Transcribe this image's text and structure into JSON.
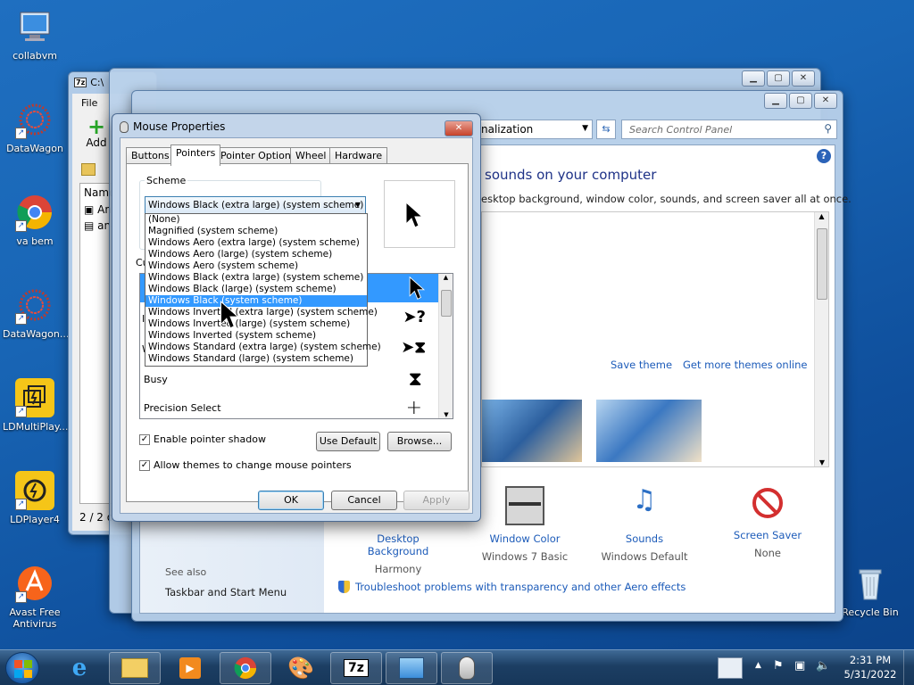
{
  "desktop_icons": [
    {
      "label": "collabvm"
    },
    {
      "label": "DataWagon"
    },
    {
      "label": "va bem"
    },
    {
      "label": "DataWagon..."
    },
    {
      "label": "LDMultiPlay..."
    },
    {
      "label": "LDPlayer4"
    },
    {
      "label": "Avast Free Antivirus"
    },
    {
      "label": "Recycle Bin"
    }
  ],
  "sevenzip_window": {
    "title": "C:\\",
    "menu_file": "File",
    "add_label": "Add",
    "col_name": "Name",
    "row1": "An",
    "row2": "ang",
    "status": "2 / 2 ob"
  },
  "control_panel": {
    "breadcrumb": "nalization",
    "search_placeholder": "Search Control Panel",
    "heading": "sounds on your computer",
    "subheading": "esktop background, window color, sounds, and screen saver all at once.",
    "save_theme": "Save theme",
    "get_more_themes": "Get more themes online",
    "bottom_items": [
      {
        "label": "Desktop Background",
        "value": "Harmony"
      },
      {
        "label": "Window Color",
        "value": "Windows 7 Basic"
      },
      {
        "label": "Sounds",
        "value": "Windows Default"
      },
      {
        "label": "Screen Saver",
        "value": "None"
      }
    ],
    "see_also": "See also",
    "taskbar_link": "Taskbar and Start Menu",
    "troubleshoot": "Troubleshoot problems with transparency and other Aero effects"
  },
  "mouse_dialog": {
    "title": "Mouse Properties",
    "tabs": [
      "Buttons",
      "Pointers",
      "Pointer Options",
      "Wheel",
      "Hardware"
    ],
    "scheme_label": "Scheme",
    "scheme_value": "Windows Black (extra large) (system scheme)",
    "scheme_options": [
      "(None)",
      "Magnified (system scheme)",
      "Windows Aero (extra large) (system scheme)",
      "Windows Aero (large) (system scheme)",
      "Windows Aero (system scheme)",
      "Windows Black (extra large) (system scheme)",
      "Windows Black (large) (system scheme)",
      "Windows Black (system scheme)",
      "Windows Inverted (extra large) (system scheme)",
      "Windows Inverted (large) (system scheme)",
      "Windows Inverted (system scheme)",
      "Windows Standard (extra large) (system scheme)",
      "Windows Standard (large) (system scheme)"
    ],
    "highlighted_index": 7,
    "customize_label": "Cu",
    "list_partials": [
      "I",
      "W"
    ],
    "row_busy": "Busy",
    "row_precision": "Precision Select",
    "enable_shadow": "Enable pointer shadow",
    "use_default": "Use Default",
    "browse": "Browse...",
    "allow_themes": "Allow themes to change mouse pointers",
    "ok": "OK",
    "cancel": "Cancel",
    "apply": "Apply"
  },
  "taskbar": {
    "time": "2:31 PM",
    "date": "5/31/2022"
  }
}
